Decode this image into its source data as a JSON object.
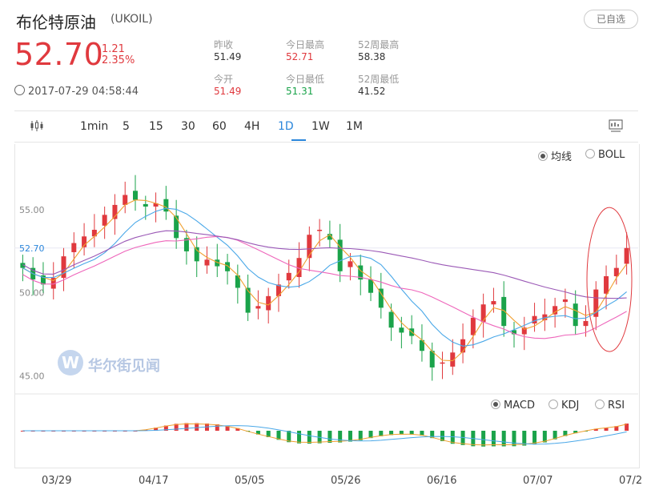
{
  "header": {
    "title": "布伦特原油",
    "code": "(UKOIL)",
    "follow_label": "已自选",
    "price": "52.70",
    "change": "1.21",
    "change_pct": "2.35%",
    "timestamp": "2017-07-29 04:58:44"
  },
  "stats": {
    "prev_close_label": "昨收",
    "prev_close": "51.49",
    "high_label": "今日最高",
    "high": "52.71",
    "high52_label": "52周最高",
    "high52": "58.38",
    "open_label": "今开",
    "open": "51.49",
    "low_label": "今日最低",
    "low": "51.31",
    "low52_label": "52周最低",
    "low52": "41.52"
  },
  "toolbar": {
    "periods": [
      "1min",
      "5",
      "15",
      "30",
      "60",
      "4H",
      "1D",
      "1W",
      "1M"
    ],
    "active": "1D"
  },
  "main_panel": {
    "opt_ma": "均线",
    "opt_boll": "BOLL",
    "y_labels": [
      "55.00",
      "52.70",
      "50.00",
      "45.00"
    ]
  },
  "sub_panel": {
    "opt_macd": "MACD",
    "opt_kdj": "KDJ",
    "opt_rsi": "RSI"
  },
  "watermark": "华尔街见闻",
  "x_labels": [
    "03/29",
    "04/17",
    "05/05",
    "05/26",
    "06/16",
    "07/07",
    "07/2"
  ],
  "colors": {
    "up": "#e0393e",
    "down": "#1aa34a",
    "accent": "#2a86db"
  },
  "chart_data": {
    "type": "line",
    "title": "",
    "xlabel": "",
    "ylabel": "",
    "ylim": [
      44,
      58
    ],
    "close_series_approx": [
      51.5,
      50.8,
      50.5,
      50.9,
      52.2,
      53.0,
      53.4,
      53.8,
      54.7,
      55.3,
      55.9,
      55.6,
      55.2,
      55.4,
      54.9,
      53.3,
      52.5,
      51.9,
      52.0,
      51.6,
      51.3,
      50.3,
      48.8,
      49.2,
      49.8,
      50.5,
      51.2,
      52.1,
      53.5,
      53.8,
      53.2,
      51.3,
      51.9,
      50.8,
      50.0,
      49.1,
      47.9,
      47.6,
      47.4,
      46.5,
      45.5,
      45.8,
      46.4,
      47.2,
      48.5,
      49.3,
      49.5,
      48.0,
      47.5,
      47.9,
      48.6,
      48.7,
      49.2,
      49.6,
      48.0,
      48.3,
      50.2,
      51.0,
      51.5,
      52.7
    ],
    "series": [
      {
        "name": "MA",
        "role": "short"
      },
      {
        "name": "MA",
        "role": "mid"
      },
      {
        "name": "MA",
        "role": "long"
      }
    ]
  }
}
